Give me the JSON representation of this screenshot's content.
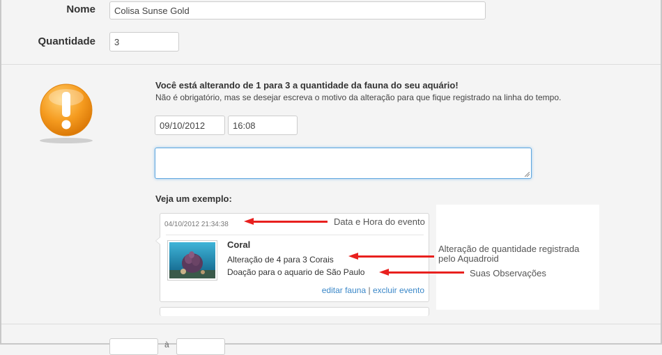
{
  "form": {
    "name_label": "Nome",
    "name_value": "Colisa Sunse Gold",
    "quantity_label": "Quantidade",
    "quantity_value": "3"
  },
  "warning": {
    "title": "Você está alterando de 1 para 3 a quantidade da fauna do seu aquário!",
    "subtitle": "Não é obrigatório, mas se desejar escreva o motivo da alteração para que fique registrado na linha do tempo.",
    "date_value": "09/10/2012",
    "time_value": "16:08",
    "note_value": ""
  },
  "example": {
    "heading": "Veja um exemplo:",
    "timestamp": "04/10/2012 21:34:38",
    "item_title": "Coral",
    "change_text": "Alteração de 4 para 3 Corais",
    "observation_text": "Doação para o aquario de São Paulo",
    "edit_link": "editar fauna",
    "separator": "|",
    "delete_link": "excluir evento"
  },
  "annotations": {
    "datetime": "Data e Hora do evento",
    "quantity_change_line1": "Alteração de quantidade registrada",
    "quantity_change_line2": "pelo Aquadroid",
    "observations": "Suas Observações"
  },
  "bottom": {
    "separator": "à"
  },
  "colors": {
    "accent_arrow": "#e8201e",
    "link": "#3a87c8",
    "warning_icon": "#f39a1e"
  }
}
